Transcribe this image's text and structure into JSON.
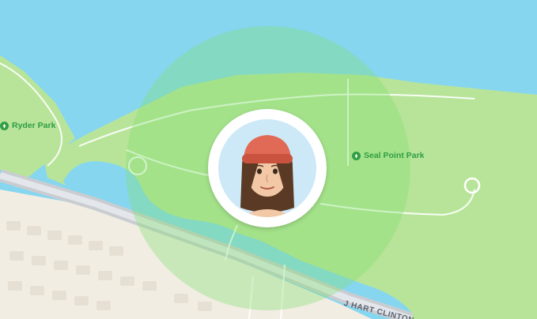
{
  "map": {
    "colors": {
      "water": "#86d6f0",
      "park": "#b8e49a",
      "urban": "#f2ede3",
      "road": "#c9ccd1",
      "geofence": "#7de06e",
      "poi_green": "#2f9e44"
    },
    "pois": [
      {
        "label": "Ryder Park",
        "icon": "tree-pin-icon"
      },
      {
        "label": "Seal Point Park",
        "icon": "tree-pin-icon"
      }
    ],
    "road_label": "J HART CLINTON",
    "person": {
      "avatar": "memoji-avatar-red-beanie",
      "has_geofence": true
    }
  }
}
